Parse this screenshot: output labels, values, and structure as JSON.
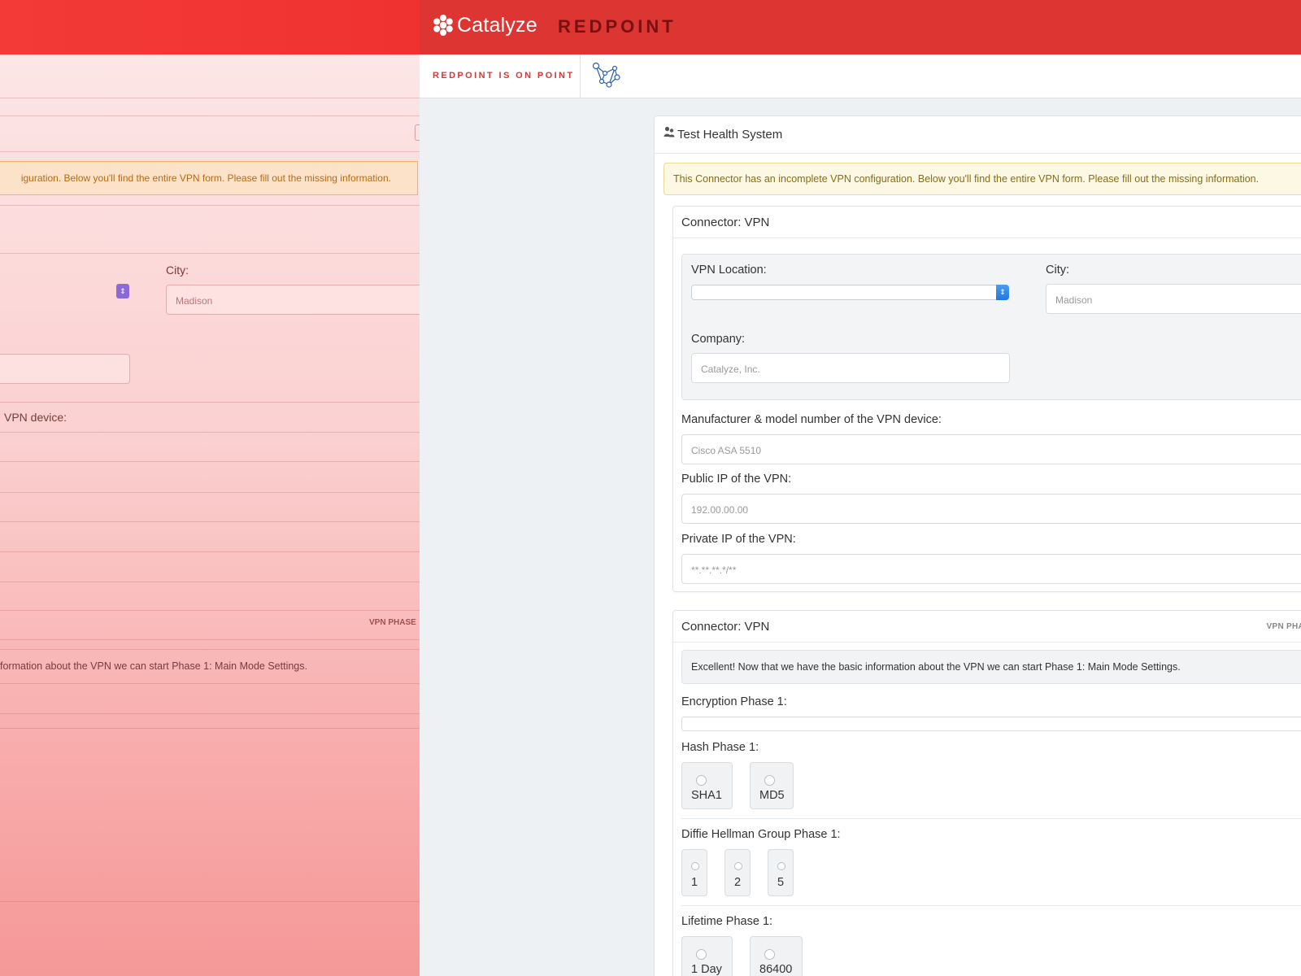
{
  "app": {
    "logo_text": "Catalyze",
    "brand": "REDPOINT",
    "tagline": "REDPOINT IS ON POINT"
  },
  "system": {
    "title": "Test Health System"
  },
  "alert": {
    "message": "This Connector has an incomplete VPN configuration. Below you'll find the entire VPN form. Please fill out the missing information."
  },
  "vpn_card": {
    "title": "Connector: VPN",
    "meta": "V",
    "vpn_location_label": "VPN Location:",
    "city_label": "City:",
    "city_placeholder": "Madison",
    "company_label": "Company:",
    "company_placeholder": "Catalyze, Inc.",
    "manufacturer_label": "Manufacturer & model number of the VPN device:",
    "manufacturer_placeholder": "Cisco ASA 5510",
    "public_ip_label": "Public IP of the VPN:",
    "public_ip_placeholder": "192.00.00.00",
    "private_ip_label": "Private IP of the VPN:",
    "private_ip_placeholder": "**.**.**.*/**"
  },
  "phase_card": {
    "title": "Connector: VPN",
    "meta": "VPN PHASE",
    "info": "Excellent! Now that we have the basic information about the VPN we can start Phase 1: Main Mode Settings.",
    "encryption_label": "Encryption Phase 1:",
    "hash_label": "Hash Phase 1:",
    "hash_options": [
      "SHA1",
      "MD5"
    ],
    "dh_label": "Diffie Hellman Group Phase 1:",
    "dh_options": [
      "1",
      "2",
      "5"
    ],
    "lifetime_label": "Lifetime Phase 1:",
    "lifetime_options": [
      "1 Day",
      "86400"
    ]
  },
  "left_overlay": {
    "alert_fragment": "iguration. Below you'll find the entire VPN form. Please fill out the missing information.",
    "city_label": "City:",
    "city_placeholder": "Madison",
    "device_fragment": "VPN device:",
    "phase_meta": "VPN PHASE",
    "info_fragment": "formation about the VPN we can start Phase 1: Main Mode Settings."
  }
}
